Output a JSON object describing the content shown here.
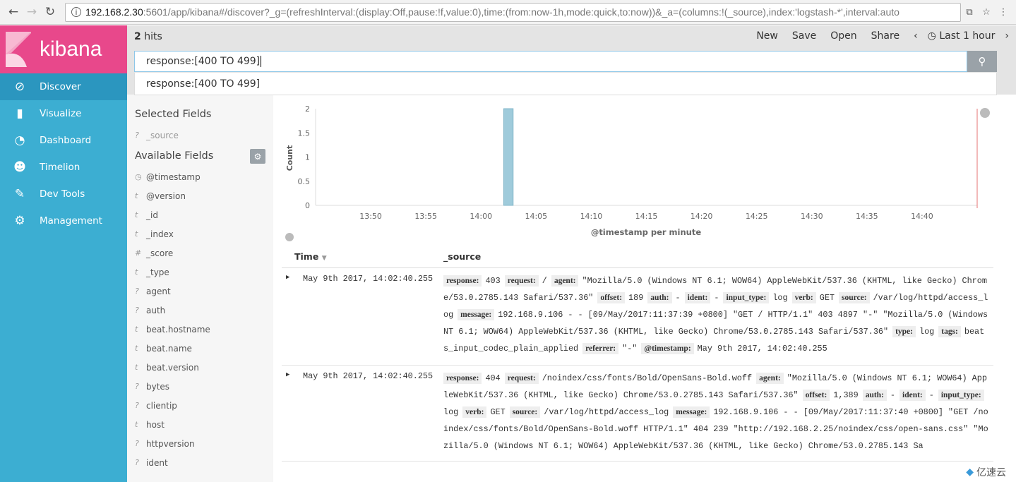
{
  "browser": {
    "url_host": "192.168.2.30",
    "url_rest": ":5601/app/kibana#/discover?_g=(refreshInterval:(display:Off,pause:!f,value:0),time:(from:now-1h,mode:quick,to:now))&_a=(columns:!(_source),index:'logstash-*',interval:auto"
  },
  "logo": "kibana",
  "nav": [
    {
      "label": "Discover",
      "icon": "compass-icon",
      "active": true
    },
    {
      "label": "Visualize",
      "icon": "bar-chart-icon"
    },
    {
      "label": "Dashboard",
      "icon": "dashboard-icon"
    },
    {
      "label": "Timelion",
      "icon": "timelion-icon"
    },
    {
      "label": "Dev Tools",
      "icon": "wrench-icon"
    },
    {
      "label": "Management",
      "icon": "gear-icon"
    }
  ],
  "hits": {
    "count": "2",
    "label": " hits"
  },
  "menu": {
    "new": "New",
    "save": "Save",
    "open": "Open",
    "share": "Share",
    "time": "Last 1 hour"
  },
  "search": {
    "value": "response:[400 TO 499]",
    "suggestion": "response:[400 TO 499]"
  },
  "fields": {
    "selected_title": "Selected Fields",
    "selected": [
      {
        "type": "?",
        "name": "_source"
      }
    ],
    "available_title": "Available Fields",
    "available": [
      {
        "type": "clock",
        "name": "@timestamp"
      },
      {
        "type": "t",
        "name": "@version"
      },
      {
        "type": "t",
        "name": "_id"
      },
      {
        "type": "t",
        "name": "_index"
      },
      {
        "type": "#",
        "name": "_score"
      },
      {
        "type": "t",
        "name": "_type"
      },
      {
        "type": "?",
        "name": "agent"
      },
      {
        "type": "?",
        "name": "auth"
      },
      {
        "type": "t",
        "name": "beat.hostname"
      },
      {
        "type": "t",
        "name": "beat.name"
      },
      {
        "type": "t",
        "name": "beat.version"
      },
      {
        "type": "?",
        "name": "bytes"
      },
      {
        "type": "?",
        "name": "clientip"
      },
      {
        "type": "t",
        "name": "host"
      },
      {
        "type": "?",
        "name": "httpversion"
      },
      {
        "type": "?",
        "name": "ident"
      }
    ]
  },
  "chart_data": {
    "type": "bar",
    "xlabel": "@timestamp per minute",
    "ylabel": "Count",
    "xlim": [
      "13:45",
      "14:45"
    ],
    "ylim": [
      0,
      2
    ],
    "xticks": [
      "13:50",
      "13:55",
      "14:00",
      "14:05",
      "14:10",
      "14:15",
      "14:20",
      "14:25",
      "14:30",
      "14:35",
      "14:40"
    ],
    "yticks": [
      "0",
      "0.5",
      "1",
      "1.5",
      "2"
    ],
    "x": [
      "14:02"
    ],
    "values": [
      2
    ],
    "bar_color": "#9fcbdb",
    "now_line_color": "#e57373"
  },
  "table": {
    "col_time": "Time",
    "col_source": "_source",
    "rows": [
      {
        "time": "May 9th 2017, 14:02:40.255",
        "fields": [
          [
            "response:",
            "403"
          ],
          [
            "request:",
            "/"
          ],
          [
            "agent:",
            "\"Mozilla/5.0 (Windows NT 6.1; WOW64) AppleWebKit/537.36 (KHTML, like Gecko) Chrome/53.0.2785.143 Safari/537.36\""
          ],
          [
            "offset:",
            "189"
          ],
          [
            "auth:",
            "-"
          ],
          [
            "ident:",
            "-"
          ],
          [
            "input_type:",
            "log"
          ],
          [
            "verb:",
            "GET"
          ],
          [
            "source:",
            "/var/log/httpd/access_log"
          ],
          [
            "message:",
            "192.168.9.106 - - [09/May/2017:11:37:39 +0800] \"GET / HTTP/1.1\" 403 4897 \"-\" \"Mozilla/5.0 (Windows NT 6.1; WOW64) AppleWebKit/537.36 (KHTML, like Gecko) Chrome/53.0.2785.143 Safari/537.36\""
          ],
          [
            "type:",
            "log"
          ],
          [
            "tags:",
            "beats_input_codec_plain_applied"
          ],
          [
            "referrer:",
            "\"-\""
          ],
          [
            "@timestamp:",
            "May 9th 2017, 14:02:40.255"
          ]
        ]
      },
      {
        "time": "May 9th 2017, 14:02:40.255",
        "fields": [
          [
            "response:",
            "404"
          ],
          [
            "request:",
            "/noindex/css/fonts/Bold/OpenSans-Bold.woff"
          ],
          [
            "agent:",
            "\"Mozilla/5.0 (Windows NT 6.1; WOW64) AppleWebKit/537.36 (KHTML, like Gecko) Chrome/53.0.2785.143 Safari/537.36\""
          ],
          [
            "offset:",
            "1,389"
          ],
          [
            "auth:",
            "-"
          ],
          [
            "ident:",
            "-"
          ],
          [
            "input_type:",
            "log"
          ],
          [
            "verb:",
            "GET"
          ],
          [
            "source:",
            "/var/log/httpd/access_log"
          ],
          [
            "message:",
            "192.168.9.106 - - [09/May/2017:11:37:40 +0800] \"GET /noindex/css/fonts/Bold/OpenSans-Bold.woff HTTP/1.1\" 404 239 \"http://192.168.2.25/noindex/css/open-sans.css\" \"Mozilla/5.0 (Windows NT 6.1; WOW64) AppleWebKit/537.36 (KHTML, like Gecko) Chrome/53.0.2785.143 Sa"
          ]
        ]
      }
    ]
  },
  "watermark": "亿速云"
}
